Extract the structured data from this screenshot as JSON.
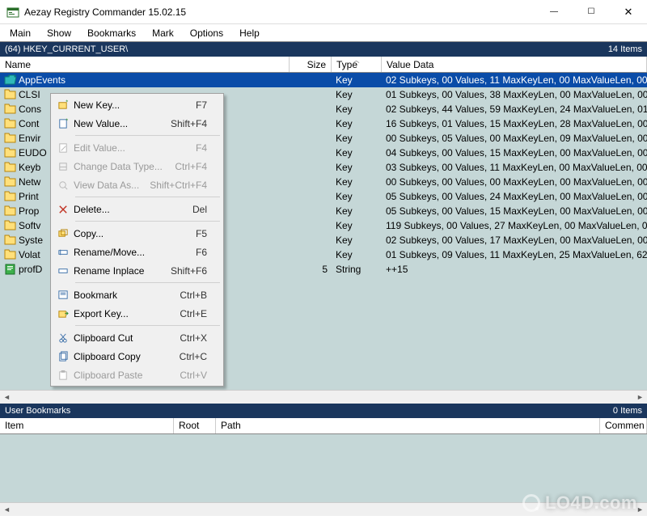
{
  "window": {
    "title": "Aezay Registry Commander 15.02.15"
  },
  "menubar": [
    "Main",
    "Show",
    "Bookmarks",
    "Mark",
    "Options",
    "Help"
  ],
  "pathbar": {
    "path": "(64) HKEY_CURRENT_USER\\",
    "count": "14 Items"
  },
  "columns": {
    "name": "Name",
    "size": "Size",
    "type": "Type",
    "value": "Value Data"
  },
  "rows": [
    {
      "name": "AppEvents",
      "size": "",
      "type": "Key",
      "value": "02 Subkeys, 00 Values, 11 MaxKeyLen, 00 MaxValueLen, 00",
      "selected": true,
      "icon": "folder-open"
    },
    {
      "name": "CLSI",
      "size": "",
      "type": "Key",
      "value": "01 Subkeys, 00 Values, 38 MaxKeyLen, 00 MaxValueLen, 00",
      "icon": "folder"
    },
    {
      "name": "Cons",
      "size": "",
      "type": "Key",
      "value": "02 Subkeys, 44 Values, 59 MaxKeyLen, 24 MaxValueLen, 01",
      "icon": "folder"
    },
    {
      "name": "Cont",
      "size": "",
      "type": "Key",
      "value": "16 Subkeys, 01 Values, 15 MaxKeyLen, 28 MaxValueLen, 00",
      "icon": "folder"
    },
    {
      "name": "Envir",
      "size": "",
      "type": "Key",
      "value": "00 Subkeys, 05 Values, 00 MaxKeyLen, 09 MaxValueLen, 00",
      "icon": "folder"
    },
    {
      "name": "EUDO",
      "size": "",
      "type": "Key",
      "value": "04 Subkeys, 00 Values, 15 MaxKeyLen, 00 MaxValueLen, 00",
      "icon": "folder"
    },
    {
      "name": "Keyb",
      "size": "",
      "type": "Key",
      "value": "03 Subkeys, 00 Values, 11 MaxKeyLen, 00 MaxValueLen, 00",
      "icon": "folder"
    },
    {
      "name": "Netw",
      "size": "",
      "type": "Key",
      "value": "00 Subkeys, 00 Values, 00 MaxKeyLen, 00 MaxValueLen, 00",
      "icon": "folder"
    },
    {
      "name": "Print",
      "size": "",
      "type": "Key",
      "value": "05 Subkeys, 00 Values, 24 MaxKeyLen, 00 MaxValueLen, 00",
      "icon": "folder"
    },
    {
      "name": "Prop",
      "size": "",
      "type": "Key",
      "value": "05 Subkeys, 00 Values, 15 MaxKeyLen, 00 MaxValueLen, 00",
      "icon": "folder"
    },
    {
      "name": "Softv",
      "size": "",
      "type": "Key",
      "value": "119 Subkeys, 00 Values, 27 MaxKeyLen, 00 MaxValueLen, 0",
      "icon": "folder"
    },
    {
      "name": "Syste",
      "size": "",
      "type": "Key",
      "value": "02 Subkeys, 00 Values, 17 MaxKeyLen, 00 MaxValueLen, 00",
      "icon": "folder"
    },
    {
      "name": "Volat",
      "size": "",
      "type": "Key",
      "value": "01 Subkeys, 09 Values, 11 MaxKeyLen, 25 MaxValueLen, 62",
      "icon": "folder"
    },
    {
      "name": "profD",
      "size": "5",
      "type": "String",
      "value": "++15",
      "icon": "string"
    }
  ],
  "bookmarks": {
    "title": "User Bookmarks",
    "count": "0 Items",
    "columns": {
      "item": "Item",
      "root": "Root",
      "path": "Path",
      "comment": "Commen"
    }
  },
  "context_menu": [
    {
      "label": "New Key...",
      "shortcut": "F7",
      "icon": "new-key"
    },
    {
      "label": "New Value...",
      "shortcut": "Shift+F4",
      "icon": "new-value"
    },
    {
      "sep": true
    },
    {
      "label": "Edit Value...",
      "shortcut": "F4",
      "disabled": true,
      "icon": "edit"
    },
    {
      "label": "Change Data Type...",
      "shortcut": "Ctrl+F4",
      "disabled": true,
      "icon": "change"
    },
    {
      "label": "View Data As...",
      "shortcut": "Shift+Ctrl+F4",
      "disabled": true,
      "icon": "view"
    },
    {
      "sep": true
    },
    {
      "label": "Delete...",
      "shortcut": "Del",
      "icon": "delete"
    },
    {
      "sep": true
    },
    {
      "label": "Copy...",
      "shortcut": "F5",
      "icon": "copy-key"
    },
    {
      "label": "Rename/Move...",
      "shortcut": "F6",
      "icon": "rename"
    },
    {
      "label": "Rename Inplace",
      "shortcut": "Shift+F6",
      "icon": "rename-inplace"
    },
    {
      "sep": true
    },
    {
      "label": "Bookmark",
      "shortcut": "Ctrl+B",
      "icon": "bookmark"
    },
    {
      "label": "Export Key...",
      "shortcut": "Ctrl+E",
      "icon": "export"
    },
    {
      "sep": true
    },
    {
      "label": "Clipboard Cut",
      "shortcut": "Ctrl+X",
      "icon": "cut"
    },
    {
      "label": "Clipboard Copy",
      "shortcut": "Ctrl+C",
      "icon": "clipboard-copy"
    },
    {
      "label": "Clipboard Paste",
      "shortcut": "Ctrl+V",
      "disabled": true,
      "icon": "paste"
    }
  ],
  "watermark": "LO4D.com"
}
